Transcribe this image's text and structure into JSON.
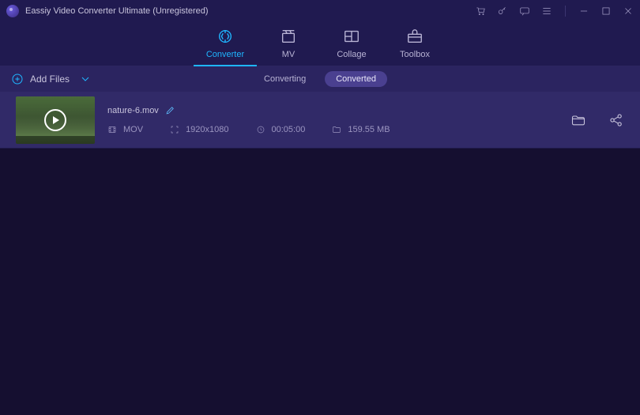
{
  "titlebar": {
    "app_title": "Eassiy Video Converter Ultimate (Unregistered)"
  },
  "nav": {
    "converter": "Converter",
    "mv": "MV",
    "collage": "Collage",
    "toolbox": "Toolbox"
  },
  "subbar": {
    "add_files": "Add Files",
    "converting": "Converting",
    "converted": "Converted"
  },
  "item": {
    "filename": "nature-6.mov",
    "format": "MOV",
    "resolution": "1920x1080",
    "duration": "00:05:00",
    "size": "159.55 MB"
  }
}
